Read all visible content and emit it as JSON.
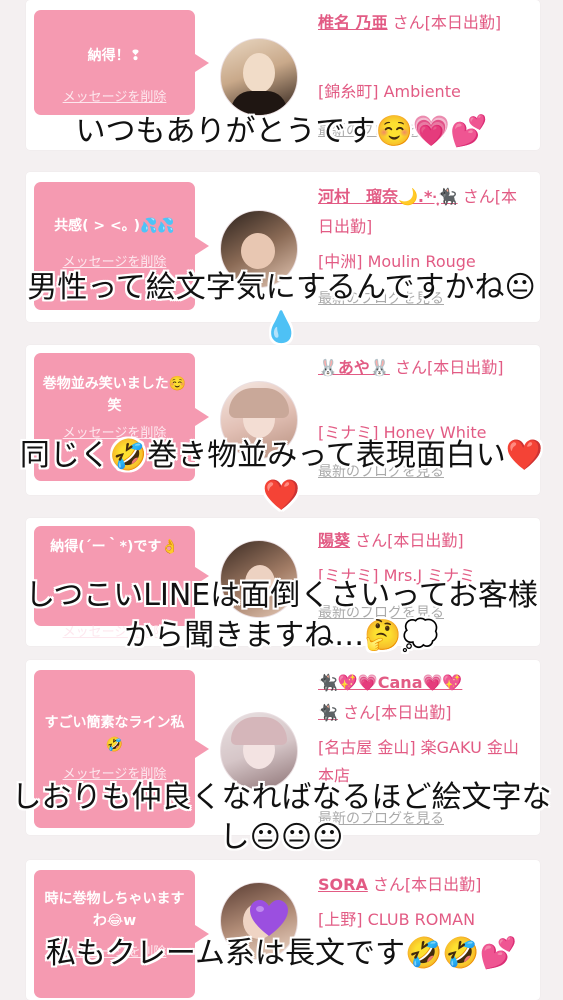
{
  "colors": {
    "bubble": "#f59ab1",
    "accent": "#e25b84",
    "background": "#f4f0f1"
  },
  "common": {
    "delete_label": "メッセージを削除",
    "blog_label": "最新のブログを見る"
  },
  "cards": [
    {
      "message": "納得！❢",
      "name": "椎名 乃亜",
      "status": " さん[本日出勤]",
      "shop": "[錦糸町] Ambiente",
      "blog": "最新のブログを見る",
      "caption": "いつもありがとうです☺️💗💕"
    },
    {
      "message": "共感( > <｡ )💦💦",
      "name": "河村　瑠奈🌙.*·̩͙🐈‍⬛",
      "status": " さん[本日出勤]",
      "shop": "[中洲] Moulin Rouge",
      "blog": "最新のブログを見る",
      "caption": "男性って絵文字気にするんですかね😐💧"
    },
    {
      "message": "巻物並み笑いました☺️笑",
      "name": "🐰あや🐰",
      "status": " さん[本日出勤]",
      "shop": "[ミナミ] Honey White",
      "blog": "最新のブログを見る",
      "caption": "同じく🤣巻き物並みって表現面白い❤️❤️"
    },
    {
      "message": "納得(´ー｀*)です👌",
      "name": "陽葵",
      "status": " さん[本日出勤]",
      "shop": "[ミナミ] Mrs.J ミナミ",
      "blog": "最新のブログを見る",
      "caption": "しつこいLINEは面倒くさいってお客様から聞きますね…🤔💭"
    },
    {
      "message": "すごい簡素なライン私🤣",
      "name": "🐈‍⬛💖💗Cana💗💖",
      "name2": "🐈‍⬛",
      "status": " さん[本日出勤]",
      "shop": "[名古屋 金山] 楽GAKU 金山本店",
      "blog": "最新のブログを見る",
      "caption": "しおりも仲良くなればなるほど絵文字なし😐😐😐"
    },
    {
      "message": "時に巻物しちゃいますわ😂w",
      "name": "SORA",
      "status": " さん[本日出勤]",
      "shop": "[上野] CLUB ROMAN",
      "blog": "最新のブログを見る",
      "caption": "私もクレーム系は長文です🤣🤣💕"
    }
  ],
  "sticker": "purple-heart"
}
